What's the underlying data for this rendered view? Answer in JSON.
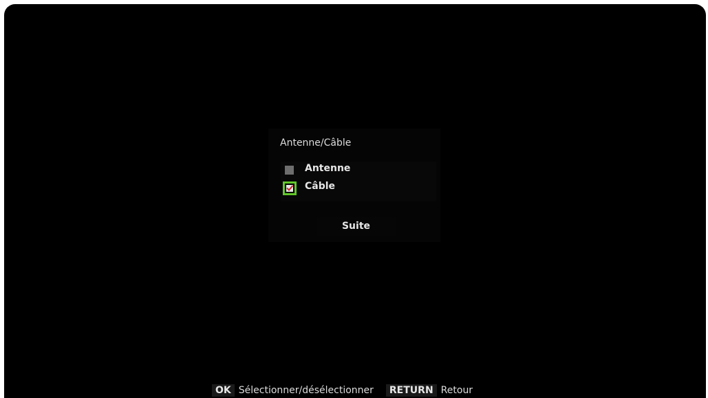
{
  "dialog": {
    "title": "Antenne/Câble",
    "options": [
      {
        "label": "Antenne",
        "checked": false
      },
      {
        "label": "Câble",
        "checked": true,
        "focused": true
      }
    ],
    "next_button_label": "Suite"
  },
  "hints": [
    {
      "key": "OK",
      "text": "Sélectionner/désélectionner"
    },
    {
      "key": "RETURN",
      "text": "Retour"
    }
  ],
  "colors": {
    "screen_background": "#000000",
    "focus_outline": "#62c82a",
    "checkmark": "#d0232a",
    "unchecked_box": "#6e6e6e",
    "text": "#e6e6e6"
  },
  "icons": {
    "checked": "checkmark-icon",
    "unchecked": "empty-checkbox-icon"
  }
}
